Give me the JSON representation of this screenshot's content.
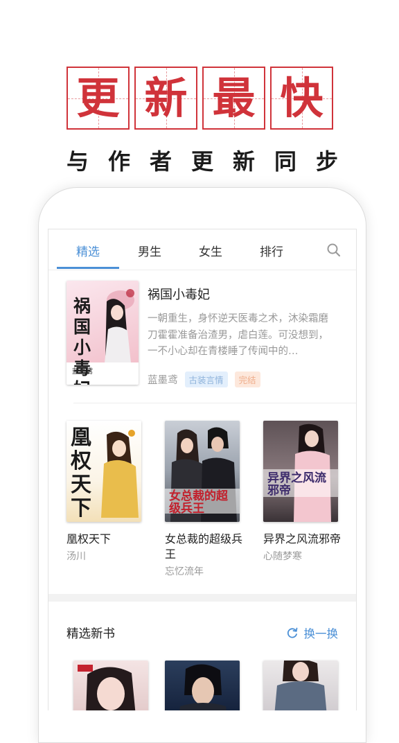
{
  "promo": {
    "title_chars": [
      "更",
      "新",
      "最",
      "快"
    ],
    "subtitle": "与作者更新同步"
  },
  "tabs": [
    {
      "label": "精选",
      "active": true
    },
    {
      "label": "男生",
      "active": false
    },
    {
      "label": "女生",
      "active": false
    },
    {
      "label": "排行",
      "active": false
    }
  ],
  "search_icon": "search-icon",
  "featured": {
    "title": "祸国小毒妃",
    "description": "一朝重生，身怀逆天医毒之术，沐染霜磨刀霍霍准备治渣男，虐白莲。可没想到，一不小心却在青楼睡了传闻中的…",
    "author": "蓝墨鸢",
    "tags": [
      {
        "label": "古装言情",
        "color": "#8fb3db"
      },
      {
        "label": "完结",
        "color": "#efae8c"
      }
    ],
    "cover_text": "祸国小毒妃",
    "cover_author": "蓝墨鸢"
  },
  "books": [
    {
      "title": "凰权天下",
      "author": "汤川",
      "cover_text": "凰权天下"
    },
    {
      "title": "女总裁的超级兵王",
      "author": "忘忆流年",
      "cover_text": "女总裁的超级兵王"
    },
    {
      "title": "异界之风流邪帝",
      "author": "心随梦寒",
      "cover_text": "异界之风流邪帝"
    }
  ],
  "new_books": {
    "title": "精选新书",
    "refresh_label": "换一换"
  },
  "colors": {
    "accent": "#4a8fd6",
    "promo_red": "#d0333a"
  }
}
